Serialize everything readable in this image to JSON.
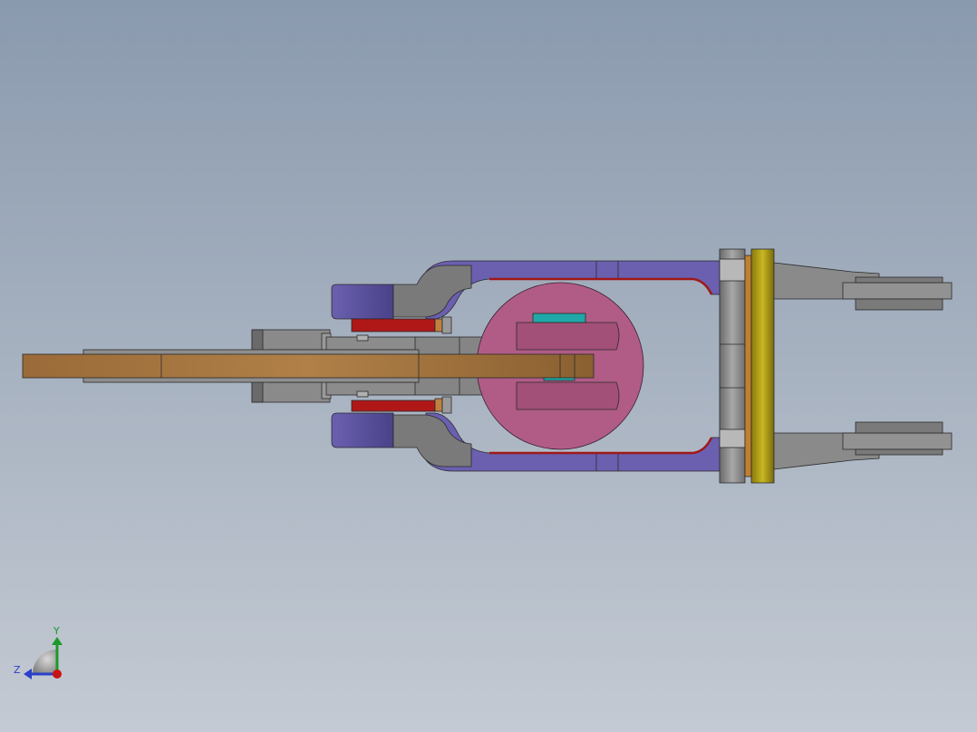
{
  "viewport": {
    "background_top": "#8a9aae",
    "background_bottom": "#c4cad3"
  },
  "axis_triad": {
    "y_label": "Y",
    "z_label": "Z",
    "y_color": "#1a9a2a",
    "z_color": "#2b3fc8",
    "x_color": "#c81414"
  },
  "parts": [
    {
      "name": "shaft",
      "color": "#a0743e"
    },
    {
      "name": "shaft-housing",
      "color": "#8a8a8a"
    },
    {
      "name": "cam-disc",
      "color": "#b05c86"
    },
    {
      "name": "cam-slot-insert",
      "color": "#20a8a8"
    },
    {
      "name": "yoke-frame",
      "color": "#6b5fb0"
    },
    {
      "name": "pivot-block",
      "color": "#5a5a9a"
    },
    {
      "name": "spring-pad",
      "color": "#b01818"
    },
    {
      "name": "mount-flange",
      "color": "#909090"
    },
    {
      "name": "brass-plate",
      "color": "#b0a018"
    },
    {
      "name": "gripper-finger",
      "color": "#808080"
    }
  ]
}
